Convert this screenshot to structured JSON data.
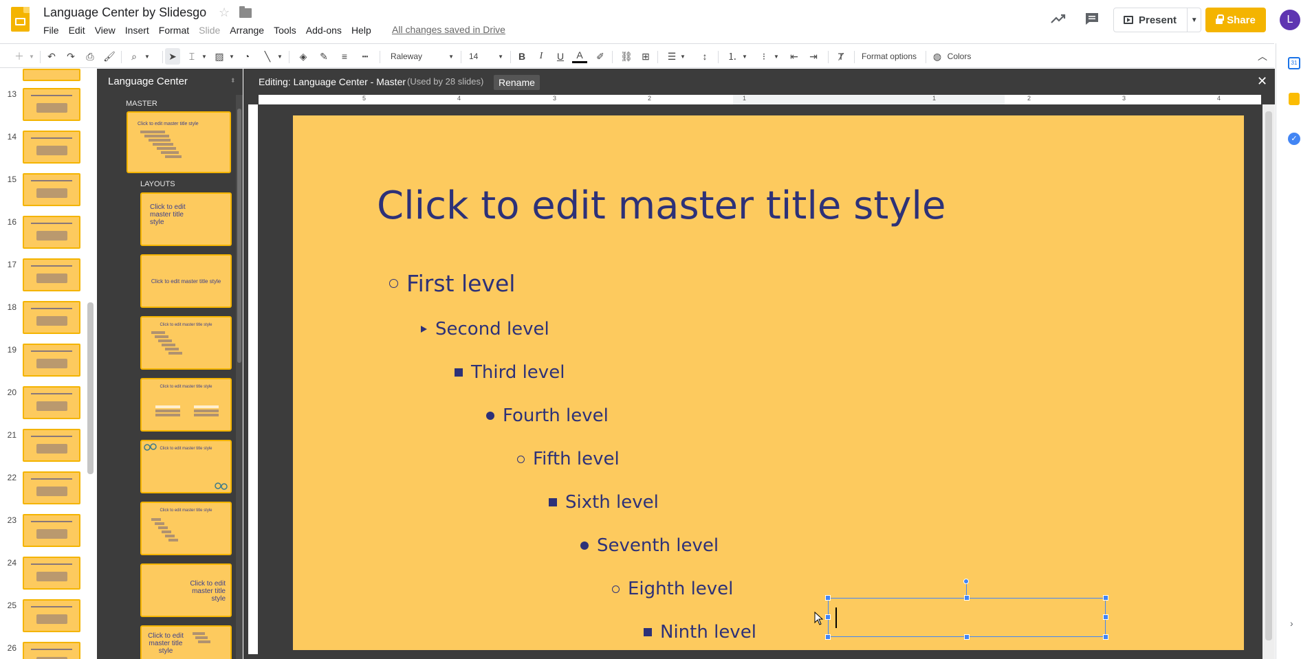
{
  "header": {
    "title": "Language Center by Slidesgo",
    "saved_status": "All changes saved in Drive",
    "present_label": "Present",
    "share_label": "Share",
    "avatar_letter": "L",
    "menu": [
      "File",
      "Edit",
      "View",
      "Insert",
      "Format",
      "Slide",
      "Arrange",
      "Tools",
      "Add-ons",
      "Help"
    ]
  },
  "toolbar": {
    "font": "Raleway",
    "font_size": "14",
    "format_options": "Format options",
    "colors": "Colors"
  },
  "filmstrip": {
    "slide_numbers": [
      "13",
      "14",
      "15",
      "16",
      "17",
      "18",
      "19",
      "20",
      "21",
      "22",
      "23",
      "24",
      "25",
      "26"
    ]
  },
  "master_panel": {
    "title": "Language Center",
    "master_label": "MASTER",
    "layouts_label": "LAYOUTS",
    "master_thumb_text": "Click to edit master title style",
    "layout_texts": [
      "Click to edit master title style",
      "Click to edit master title style",
      "Click to edit master title style",
      "Click to edit master title style",
      "Click to edit master title style",
      "Click to edit master title style",
      "Click to edit master title style",
      "Click to edit master title style"
    ]
  },
  "editor": {
    "editing_label": "Editing: Language Center - Master",
    "used_label": "(Used by 28 slides)",
    "rename_label": "Rename",
    "ruler_numbers": [
      "5",
      "4",
      "3",
      "2",
      "1",
      "1",
      "2",
      "3",
      "4"
    ]
  },
  "slide": {
    "title": "Click to edit master title style",
    "levels": [
      "First level",
      "Second level",
      "Third level",
      "Fourth level",
      "Fifth level",
      "Sixth level",
      "Seventh level",
      "Eighth level",
      "Ninth level"
    ]
  },
  "colors": {
    "slide_bg": "#fdca5e",
    "text": "#2d3178",
    "accent": "#f4b400",
    "selection": "#4285f4"
  }
}
